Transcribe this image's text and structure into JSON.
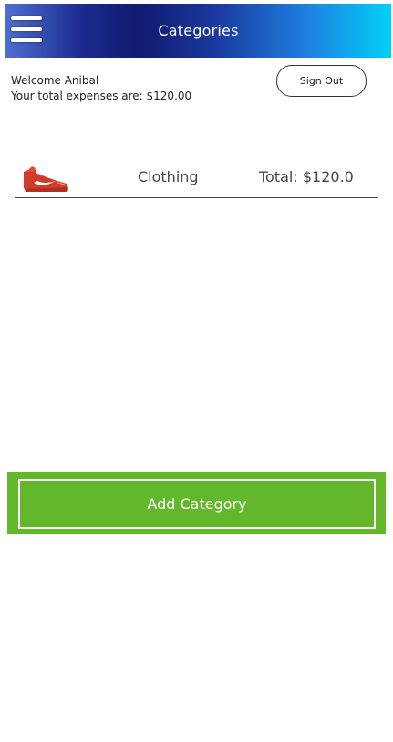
{
  "header": {
    "title": "Categories",
    "menu_icon": "hamburger-menu-icon"
  },
  "user": {
    "welcome_text": "Welcome Anibal",
    "total_text": "Your total expenses are: $120.00"
  },
  "actions": {
    "sign_out_label": "Sign Out",
    "add_category_label": "Add Category"
  },
  "categories": [
    {
      "icon": "sneaker-icon",
      "name": "Clothing",
      "total_text": "Total: $120.0"
    }
  ],
  "colors": {
    "header_gradient_start": "#4f6fd0",
    "header_gradient_mid": "#0f1b6f",
    "header_gradient_end": "#00d0f8",
    "add_button_bg": "#62b82a"
  }
}
